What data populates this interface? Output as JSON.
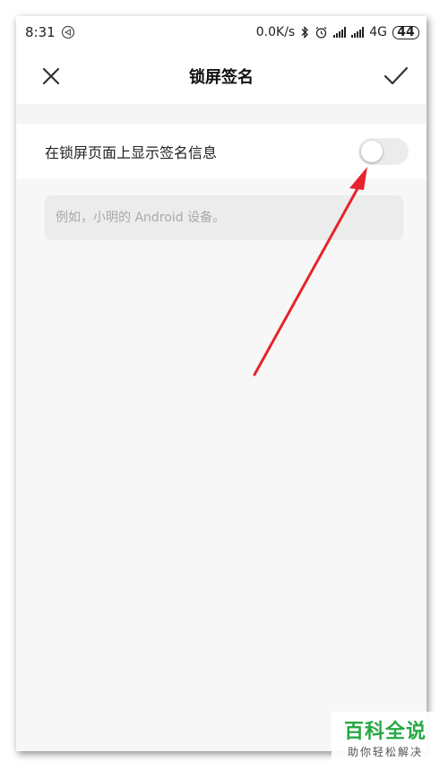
{
  "status_bar": {
    "time": "8:31",
    "network_speed": "0.0K/s",
    "network_type": "4G",
    "battery": "44",
    "icons": [
      "navigation-icon",
      "bluetooth-icon",
      "alarm-icon",
      "signal-icon",
      "signal-icon",
      "battery-icon"
    ]
  },
  "header": {
    "title": "锁屏签名",
    "close_icon": "close-icon",
    "confirm_icon": "check-icon"
  },
  "setting": {
    "label": "在锁屏页面上显示签名信息",
    "toggle_on": false
  },
  "signature_input": {
    "value": "",
    "placeholder": "例如，小明的 Android 设备。"
  },
  "watermark": {
    "main": "百科全说",
    "sub": "助你轻松解决"
  },
  "colors": {
    "arrow": "#e8232b",
    "watermark_green": "#27a844",
    "page_bg": "#f7f7f7"
  }
}
